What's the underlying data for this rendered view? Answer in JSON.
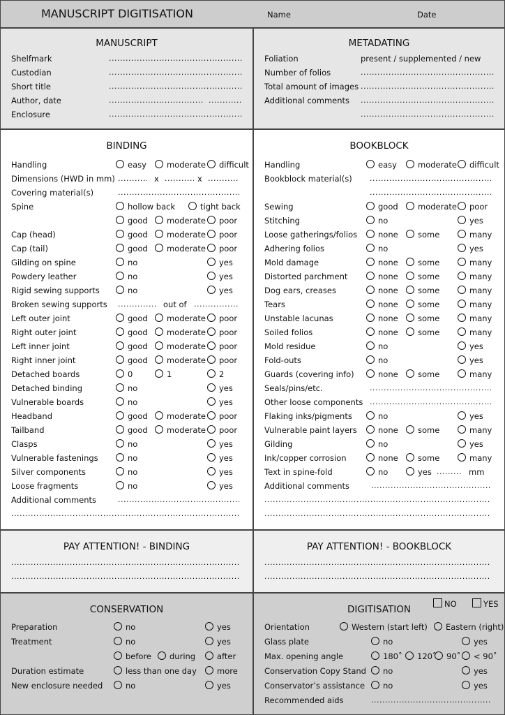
{
  "header": {
    "title": "MANUSCRIPT DIGITISATION",
    "name_label": "Name",
    "date_label": "Date"
  },
  "dots": {
    "long": "......................................................",
    "full": "..........................................................................................................",
    "short": "...........",
    "mid": "................",
    "tiny": "........."
  },
  "manuscript": {
    "title": "MANUSCRIPT",
    "fields": [
      "Shelfmark",
      "Custodian",
      "Short title",
      "Author, date",
      "Enclosure"
    ]
  },
  "metadating": {
    "title": "METADATING",
    "foliation_label": "Foliation",
    "foliation_value": "present / supplemented / new",
    "fields": [
      "Number of folios",
      "Total amount of images",
      "Additional comments"
    ]
  },
  "binding": {
    "title": "BINDING",
    "handling": {
      "label": "Handling",
      "opts": [
        "easy",
        "moderate",
        "difficult"
      ]
    },
    "dimensions": {
      "label": "Dimensions (HWD in mm)",
      "sep": "x"
    },
    "covering": "Covering material(s)",
    "spine": {
      "label": "Spine",
      "opts": [
        "hollow back",
        "tight back"
      ],
      "cond": [
        "good",
        "moderate",
        "poor"
      ]
    },
    "gmp_rows": [
      "Cap (head)",
      "Cap (tail)"
    ],
    "ny_rows_a": [
      "Gilding on spine",
      "Powdery leather",
      "Rigid sewing supports"
    ],
    "broken": {
      "label": "Broken sewing supports",
      "mid": "out of"
    },
    "joint_rows": [
      "Left outer joint",
      "Right outer joint",
      "Left inner joint",
      "Right inner joint"
    ],
    "detached_boards": {
      "label": "Detached boards",
      "opts": [
        "0",
        "1",
        "2"
      ]
    },
    "ny_rows_b": [
      "Detached binding",
      "Vulnerable boards"
    ],
    "band_rows": [
      "Headband",
      "Tailband"
    ],
    "ny_rows_c": [
      "Clasps",
      "Vulnerable fastenings",
      "Silver components",
      "Loose fragments"
    ],
    "comments": "Additional comments",
    "gmp": [
      "good",
      "moderate",
      "poor"
    ],
    "ny": [
      "no",
      "yes"
    ]
  },
  "bookblock": {
    "title": "BOOKBLOCK",
    "handling": {
      "label": "Handling",
      "opts": [
        "easy",
        "moderate",
        "difficult"
      ]
    },
    "material": "Bookblock material(s)",
    "sewing": {
      "label": "Sewing",
      "opts": [
        "good",
        "moderate",
        "poor"
      ]
    },
    "rows": [
      {
        "label": "Stitching",
        "type": "ny"
      },
      {
        "label": "Loose gatherings/folios",
        "type": "nsm"
      },
      {
        "label": "Adhering folios",
        "type": "ny"
      },
      {
        "label": "Mold damage",
        "type": "nsm"
      },
      {
        "label": "Distorted parchment",
        "type": "nsm"
      },
      {
        "label": "Dog ears, creases",
        "type": "nsm"
      },
      {
        "label": "Tears",
        "type": "nsm"
      },
      {
        "label": "Unstable lacunas",
        "type": "nsm"
      },
      {
        "label": "Soiled folios",
        "type": "nsm"
      },
      {
        "label": "Mold residue",
        "type": "ny"
      },
      {
        "label": "Fold-outs",
        "type": "ny"
      },
      {
        "label": "Guards (covering info)",
        "type": "nsm"
      }
    ],
    "seals": "Seals/pins/etc.",
    "other": "Other loose components",
    "rows2": [
      {
        "label": "Flaking inks/pigments",
        "type": "ny"
      },
      {
        "label": "Vulnerable paint layers",
        "type": "nsm"
      },
      {
        "label": "Gilding",
        "type": "ny"
      },
      {
        "label": "Ink/copper corrosion",
        "type": "nsm"
      }
    ],
    "spinefold": {
      "label": "Text in spine-fold",
      "no": "no",
      "yes": "yes",
      "unit": "mm"
    },
    "comments": "Additional comments",
    "nsm": [
      "none",
      "some",
      "many"
    ],
    "ny": [
      "no",
      "yes"
    ]
  },
  "attention": {
    "binding_title": "PAY ATTENTION! - BINDING",
    "bookblock_title": "PAY ATTENTION! - BOOKBLOCK"
  },
  "conservation": {
    "title": "CONSERVATION",
    "preparation": "Preparation",
    "treatment": "Treatment",
    "timing": [
      "before",
      "during",
      "after"
    ],
    "duration": {
      "label": "Duration estimate",
      "opts": [
        "less than one day",
        "more"
      ]
    },
    "enclosure": "New enclosure needed",
    "ny": [
      "no",
      "yes"
    ]
  },
  "digitisation": {
    "title": "DIGITISATION",
    "toggle": [
      "NO",
      "YES"
    ],
    "orientation": {
      "label": "Orientation",
      "opts": [
        "Western (start left)",
        "Eastern (right)"
      ]
    },
    "glass": "Glass plate",
    "angle": {
      "label": "Max. opening angle",
      "opts": [
        "180˚",
        "120˚",
        "90˚",
        "< 90˚"
      ]
    },
    "copystand": "Conservation Copy Stand",
    "assistance": "Conservator’s assistance",
    "aids": "Recommended aids",
    "ny": [
      "no",
      "yes"
    ]
  }
}
